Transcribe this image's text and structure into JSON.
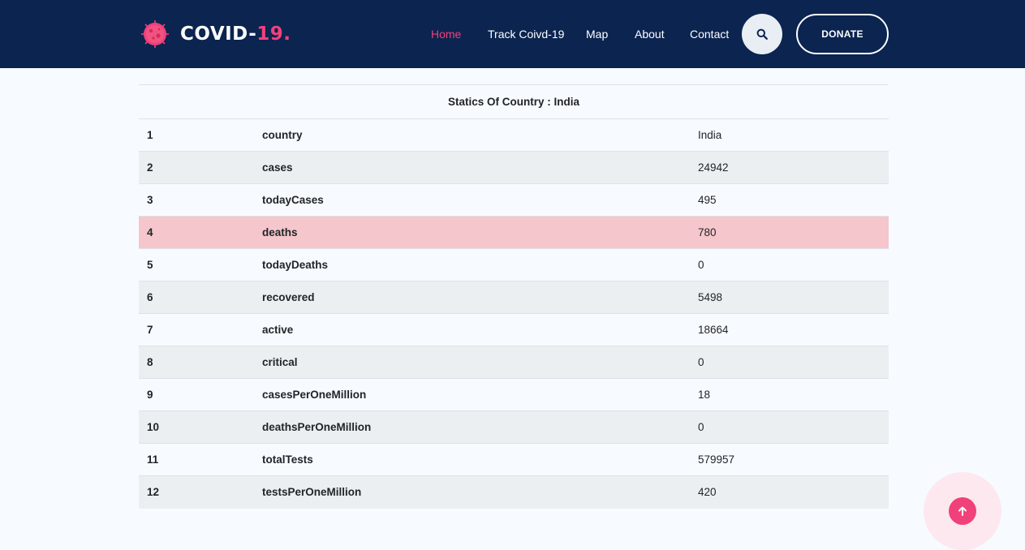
{
  "brand": {
    "name": "COVID-",
    "accent": "19.",
    "logo": "virus-logo"
  },
  "nav": {
    "items": [
      {
        "label": "Home",
        "active": true
      },
      {
        "label": "Track Coivd-19",
        "active": false
      },
      {
        "label": "Map",
        "active": false
      },
      {
        "label": "About",
        "active": false
      },
      {
        "label": "Contact",
        "active": false
      }
    ],
    "search_icon": "search-icon",
    "donate_label": "DONATE"
  },
  "table": {
    "title": "Statics Of Country : India",
    "rows": [
      {
        "num": "1",
        "key": "country",
        "value": "India"
      },
      {
        "num": "2",
        "key": "cases",
        "value": "24942"
      },
      {
        "num": "3",
        "key": "todayCases",
        "value": "495"
      },
      {
        "num": "4",
        "key": "deaths",
        "value": "780",
        "highlight": true
      },
      {
        "num": "5",
        "key": "todayDeaths",
        "value": "0"
      },
      {
        "num": "6",
        "key": "recovered",
        "value": "5498"
      },
      {
        "num": "7",
        "key": "active",
        "value": "18664"
      },
      {
        "num": "8",
        "key": "critical",
        "value": "0"
      },
      {
        "num": "9",
        "key": "casesPerOneMillion",
        "value": "18"
      },
      {
        "num": "10",
        "key": "deathsPerOneMillion",
        "value": "0"
      },
      {
        "num": "11",
        "key": "totalTests",
        "value": "579957"
      },
      {
        "num": "12",
        "key": "testsPerOneMillion",
        "value": "420"
      }
    ]
  },
  "scroll_top_icon": "arrow-up-icon",
  "colors": {
    "navbar": "#0b2450",
    "accent": "#f0417a",
    "highlight_row": "#f5c6cb",
    "striped_row": "#eceff2"
  }
}
